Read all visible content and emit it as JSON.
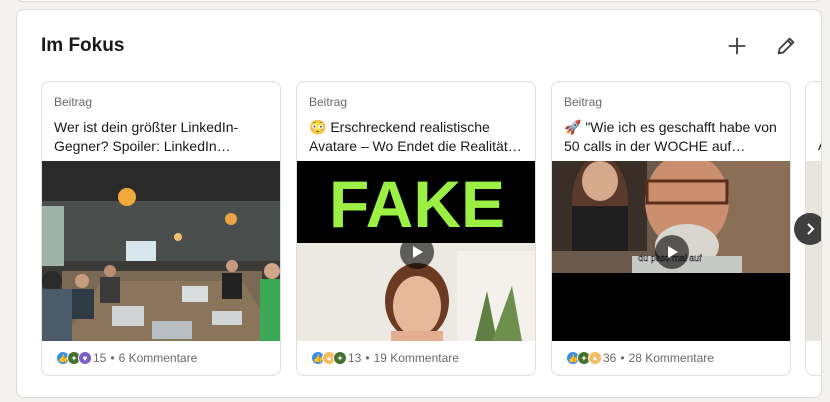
{
  "section": {
    "title": "Im Fokus"
  },
  "cards": [
    {
      "type_label": "Beitrag",
      "text": "Wer ist dein größter LinkedIn-Gegner? Spoiler: LinkedIn…",
      "reactions_count": "15",
      "separator": "•",
      "comments": "6 Kommentare",
      "has_video": false
    },
    {
      "type_label": "Beitrag",
      "text": "😳 Erschreckend realistische Avatare – Wo Endet die Realität…",
      "overlay_text": "FAKE",
      "reactions_count": "13",
      "separator": "•",
      "comments": "19 Kommentare",
      "has_video": true
    },
    {
      "type_label": "Beitrag",
      "text": "🚀 \"Wie ich es geschafft habe von 50 calls in der WOCHE auf…",
      "subtitle": "du pass mal auf",
      "reactions_count": "36",
      "separator": "•",
      "comments": "28 Kommentare",
      "has_video": true
    }
  ],
  "partial_card": {
    "text_a": "",
    "text_b": "A"
  },
  "colors": {
    "accent_fake": "#9cf045",
    "like_blue": "#378fe9",
    "support_purple": "#7a5fc4",
    "celebrate_green": "#44712e",
    "insightful_yellow": "#f5bb5c"
  },
  "icons": {
    "add": "plus-icon",
    "edit": "pencil-icon",
    "next": "chevron-right-icon",
    "play": "play-icon"
  }
}
